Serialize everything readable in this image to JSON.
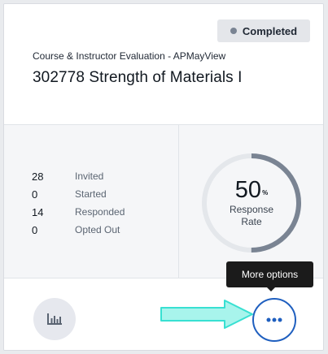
{
  "card": {
    "status": "Completed",
    "subtitle": "Course & Instructor Evaluation - APMayView",
    "title": "302778 Strength of Materials I"
  },
  "stats": [
    {
      "value": "28",
      "label": "Invited"
    },
    {
      "value": "0",
      "label": "Started"
    },
    {
      "value": "14",
      "label": "Responded"
    },
    {
      "value": "0",
      "label": "Opted Out"
    }
  ],
  "response": {
    "value": "50",
    "unit": "%",
    "fraction": 0.5,
    "label_line1": "Response",
    "label_line2": "Rate"
  },
  "tooltip": "More options",
  "icons": {
    "chart": "bar-chart-icon",
    "more": "more-dots-icon",
    "status": "status-dot-icon",
    "pointer": "arrow-right-icon"
  },
  "colors": {
    "accent": "#1f5fbf",
    "ring": "#7a8493",
    "ring_track": "#e4e7eb",
    "pointer": "#38e0d2"
  }
}
